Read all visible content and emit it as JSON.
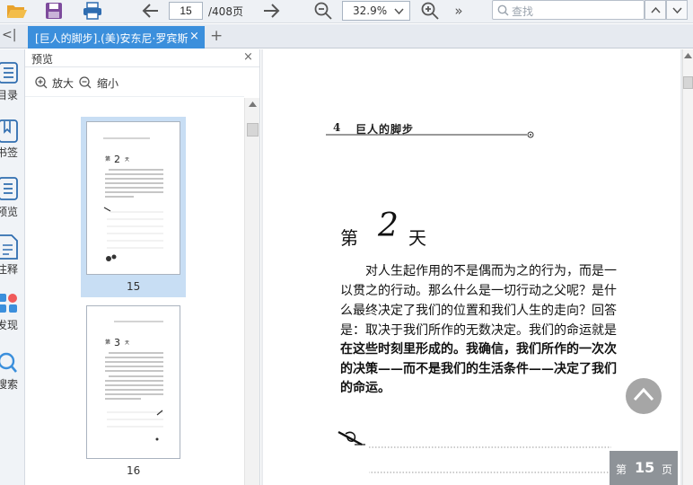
{
  "toolbar": {
    "icons": [
      "open-folder-icon",
      "save-icon",
      "print-icon",
      "back-arrow-icon",
      "forward-arrow-icon",
      "zoom-out-icon",
      "zoom-in-icon",
      "more-icon",
      "search-icon",
      "prev-result-icon",
      "next-result-icon"
    ],
    "current_page": "15",
    "total_pages": "/408页",
    "zoom": "32.9%",
    "more_label": "»",
    "search_placeholder": "查找"
  },
  "tabs": {
    "collapse_label": "<|",
    "active_title": "[巨人的脚步].(美)安东尼·罗宾斯.",
    "close_label": "×",
    "add_label": "+"
  },
  "rail": {
    "items": [
      {
        "label": "目录",
        "icon": "toc-icon"
      },
      {
        "label": "书签",
        "icon": "bookmark-icon"
      },
      {
        "label": "预览",
        "icon": "preview-icon"
      },
      {
        "label": "注释",
        "icon": "annotation-icon"
      },
      {
        "label": "发现",
        "icon": "discover-icon"
      },
      {
        "label": "搜索",
        "icon": "search-icon"
      }
    ]
  },
  "preview_panel": {
    "title": "预览",
    "close_label": "×",
    "zoom_in_label": "放大",
    "zoom_out_label": "缩小",
    "thumbnails": [
      {
        "page": "15",
        "selected": true
      },
      {
        "page": "16",
        "selected": false
      }
    ]
  },
  "document": {
    "running_head_number": "4",
    "running_head_title": "巨人的脚步",
    "day_heading_pre": "第",
    "day_heading_number": "2",
    "day_heading_post": "天",
    "paragraph_lines": [
      {
        "text": "　　对人生起作用的不是偶而为之的行为，而是一",
        "bold": false
      },
      {
        "text": "以贯之的行动。那么什么是一切行动之父呢？是什",
        "bold": false
      },
      {
        "text": "么最终决定了我们的位置和我们人生的走向？回答",
        "bold": false
      },
      {
        "text": "是：取决于我们所作的无数决定。我们的命运就是",
        "bold": false
      },
      {
        "text": "在这些时刻里形成的。我确信，我们所作的一次次",
        "bold": true
      },
      {
        "text": "的决策——而不是我们的生活条件——决定了我们",
        "bold": true
      },
      {
        "text": "的命运。",
        "bold": true
      }
    ]
  },
  "page_indicator": {
    "prefix": "第",
    "number": "15",
    "suffix": "页"
  },
  "colors": {
    "accent_tab": "#3b8fdc",
    "thumbnail_selected": "#c8def4",
    "toolbar_bg": "#eef1f5",
    "indicator_bg": "#8e9398"
  }
}
